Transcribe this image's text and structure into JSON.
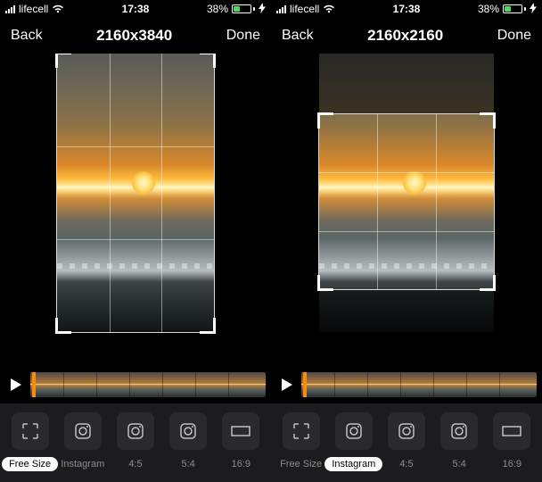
{
  "panes": [
    {
      "status": {
        "carrier": "lifecell",
        "time": "17:38",
        "battery_pct": "38%"
      },
      "nav": {
        "back": "Back",
        "title": "2160x3840",
        "done": "Done"
      },
      "crop_options": [
        {
          "label": "Free Size",
          "selected": true
        },
        {
          "label": "Instagram",
          "selected": false
        },
        {
          "label": "4:5",
          "selected": false
        },
        {
          "label": "5:4",
          "selected": false
        },
        {
          "label": "16:9",
          "selected": false
        }
      ]
    },
    {
      "status": {
        "carrier": "lifecell",
        "time": "17:38",
        "battery_pct": "38%"
      },
      "nav": {
        "back": "Back",
        "title": "2160x2160",
        "done": "Done"
      },
      "crop_options": [
        {
          "label": "Free Size",
          "selected": false
        },
        {
          "label": "Instagram",
          "selected": true
        },
        {
          "label": "4:5",
          "selected": false
        },
        {
          "label": "5:4",
          "selected": false
        },
        {
          "label": "16:9",
          "selected": false
        }
      ]
    }
  ],
  "battery_fill_pct": 38,
  "battery_color": "#4cd964"
}
